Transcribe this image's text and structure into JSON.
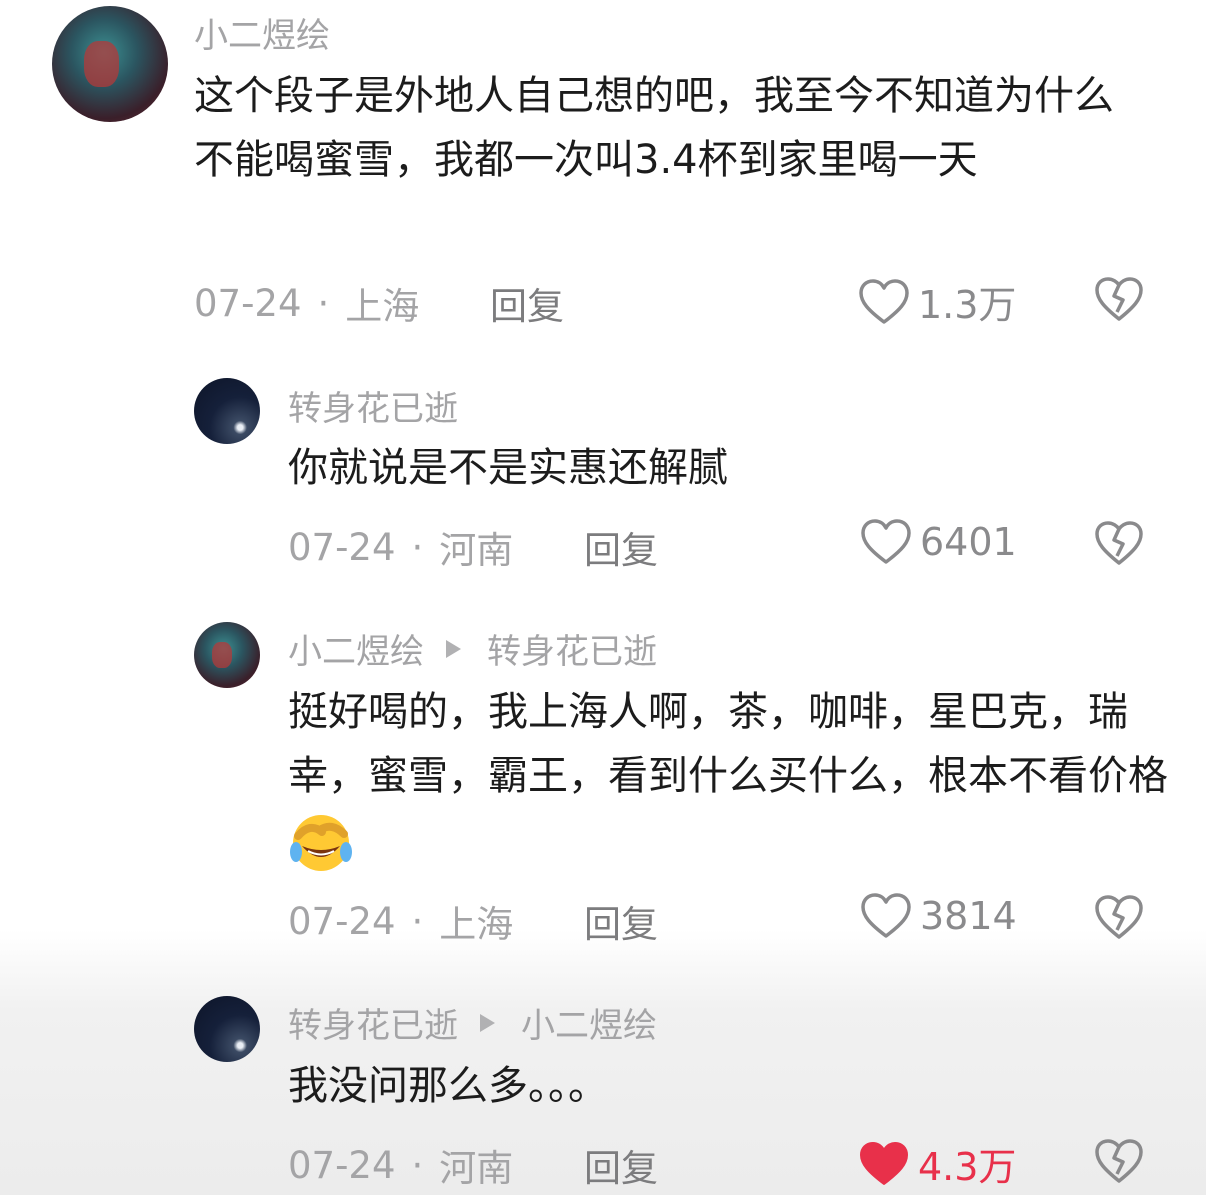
{
  "comments": [
    {
      "user": "小二煜绘",
      "text": "这个段子是外地人自己想的吧，我至今不知道为什么不能喝蜜雪，我都一次叫3.4杯到家里喝一天",
      "date": "07-24",
      "location": "上海",
      "reply_label": "回复",
      "likes": "1.3万",
      "liked": false
    },
    {
      "user": "转身花已逝",
      "text": "你就说是不是实惠还解腻",
      "date": "07-24",
      "location": "河南",
      "reply_label": "回复",
      "likes": "6401",
      "liked": false
    },
    {
      "user": "小二煜绘",
      "reply_to": "转身花已逝",
      "text": "挺好喝的，我上海人啊，茶，咖啡，星巴克，瑞幸，蜜雪，霸王，看到什么买什么，根本不看价格",
      "emoji": "face-with-tears-of-joy-covering-eyes",
      "date": "07-24",
      "location": "上海",
      "reply_label": "回复",
      "likes": "3814",
      "liked": false
    },
    {
      "user": "转身花已逝",
      "reply_to": "小二煜绘",
      "text": "我没问那么多。。。",
      "date": "07-24",
      "location": "河南",
      "reply_label": "回复",
      "likes": "4.3万",
      "liked": true
    }
  ],
  "separator": "·",
  "colors": {
    "liked": "#e8304a",
    "meta": "#a4a4a6",
    "text": "#1c1c1c"
  },
  "icons": {
    "like": "heart-outline-icon",
    "liked": "heart-filled-icon",
    "dislike": "broken-heart-icon",
    "reply_arrow": "play-triangle-icon"
  }
}
